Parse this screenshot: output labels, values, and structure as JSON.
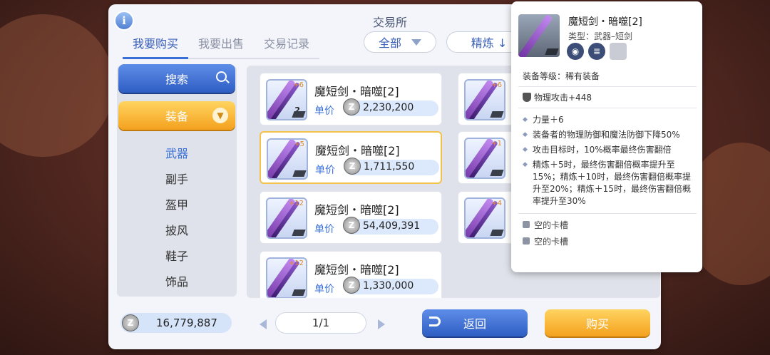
{
  "window": {
    "title": "交易所"
  },
  "tabs": [
    {
      "label": "我要购买",
      "active": true
    },
    {
      "label": "我要出售",
      "active": false
    },
    {
      "label": "交易记录",
      "active": false
    }
  ],
  "filters": {
    "category": "全部",
    "sort": "精炼 ↓"
  },
  "sidebar": {
    "search_label": "搜索",
    "group_label": "装备",
    "categories": [
      "武器",
      "副手",
      "盔甲",
      "披风",
      "鞋子",
      "饰品"
    ]
  },
  "listings": [
    {
      "name": "魔短剑・暗噬[2]",
      "price_label": "单价",
      "price": "2,230,200",
      "refine": "+6",
      "qty": "2"
    },
    {
      "name": "魔短剑・暗噬[2]",
      "price_label": "单价",
      "price": "1,711,550",
      "refine": "+5",
      "qty": ""
    },
    {
      "name": "魔短剑・暗噬[2]",
      "price_label": "单价",
      "price": "54,409,391",
      "refine": "+12",
      "qty": ""
    },
    {
      "name": "魔短剑・暗噬[2]",
      "price_label": "单价",
      "price": "1,330,000",
      "refine": "+12",
      "qty": ""
    }
  ],
  "listings_right_refine": [
    "+6",
    "+1",
    "+4"
  ],
  "footer": {
    "balance": "16,779,887",
    "page": "1/1",
    "back_label": "返回",
    "buy_label": "购买"
  },
  "tooltip": {
    "name": "魔短剑・暗噬[2]",
    "type": "类型：武器–短剑",
    "grade": "装备等级：稀有装备",
    "attack": "物理攻击+448",
    "effects": [
      "力量＋6",
      "装备者的物理防御和魔法防御下降50%",
      "攻击目标时，10%概率最终伤害翻倍",
      "精炼＋5时，最终伤害翻倍概率提升至15%；精炼＋10时，最终伤害翻倍概率提升至20%；精炼＋15时，最终伤害翻倍概率提升至30%"
    ],
    "slots": [
      "空的卡槽",
      "空的卡槽"
    ]
  },
  "icons": {
    "info": "info-icon",
    "search": "search-icon",
    "coin": "zeny-coin-icon"
  },
  "colors": {
    "accent_blue": "#3a6fd8",
    "accent_orange": "#f4a11e"
  }
}
